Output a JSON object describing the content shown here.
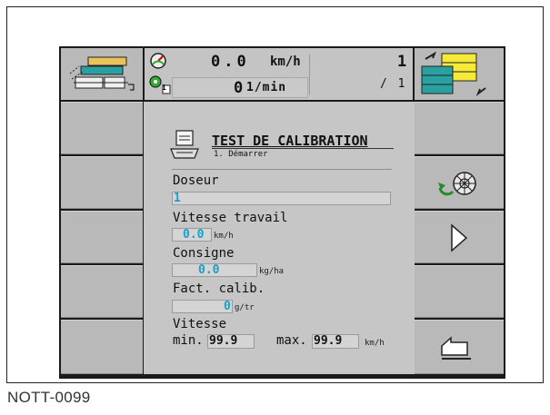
{
  "header": {
    "speed_value": "0.0",
    "speed_unit": "km/h",
    "rpm_value": "0",
    "rpm_unit": "1/min",
    "counter_top": "1",
    "counter_bottom": "/ 1",
    "pto_badge": "1"
  },
  "dialog": {
    "title": "TEST DE CALIBRATION",
    "subtitle": "1. Démarrer",
    "fields": {
      "doseur": {
        "label": "Doseur",
        "value": "1"
      },
      "vitesse_travail": {
        "label": "Vitesse travail",
        "value": "0.0",
        "unit": "km/h"
      },
      "consigne": {
        "label": "Consigne",
        "value": "0.0",
        "unit": "kg/ha"
      },
      "fact_calib": {
        "label": "Fact. calib.",
        "value": "0",
        "unit": "g/tr"
      },
      "vitesse_minmax": {
        "label": "Vitesse",
        "min_label": "min.",
        "min_value": "99.9",
        "max_label": "max.",
        "max_value": "99.9",
        "unit": "km/h"
      }
    }
  },
  "caption": "NOTT-0099",
  "colors": {
    "accent_cyan": "#1a9fc9",
    "panel_gray": "#c6c6c6",
    "button_gray": "#b9b9b9",
    "screen_bg": "#1a1a1a"
  }
}
